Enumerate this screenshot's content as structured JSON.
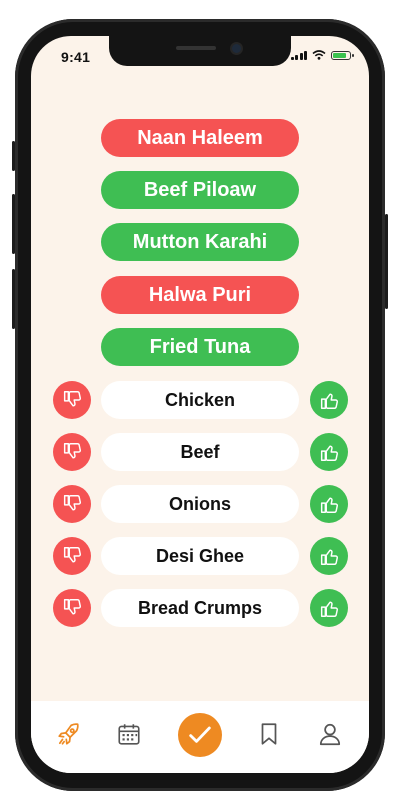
{
  "status_bar": {
    "time": "9:41"
  },
  "dishes": [
    {
      "label": "Naan Haleem",
      "status": "red"
    },
    {
      "label": "Beef Piloaw",
      "status": "green"
    },
    {
      "label": "Mutton Karahi",
      "status": "green"
    },
    {
      "label": "Halwa Puri",
      "status": "red"
    },
    {
      "label": "Fried Tuna",
      "status": "green"
    }
  ],
  "ingredients": [
    {
      "label": "Chicken"
    },
    {
      "label": "Beef"
    },
    {
      "label": "Onions"
    },
    {
      "label": "Desi Ghee"
    },
    {
      "label": "Bread Crumps"
    }
  ],
  "colors": {
    "background": "#fcf3ea",
    "red": "#f55353",
    "green": "#3fbe53",
    "accent_orange": "#ee8a22"
  },
  "tab_bar": {
    "items": [
      {
        "icon": "rocket-icon",
        "active": true
      },
      {
        "icon": "calendar-icon",
        "active": false
      },
      {
        "icon": "check-icon",
        "active": false
      },
      {
        "icon": "bookmark-icon",
        "active": false
      },
      {
        "icon": "user-icon",
        "active": false
      }
    ]
  }
}
